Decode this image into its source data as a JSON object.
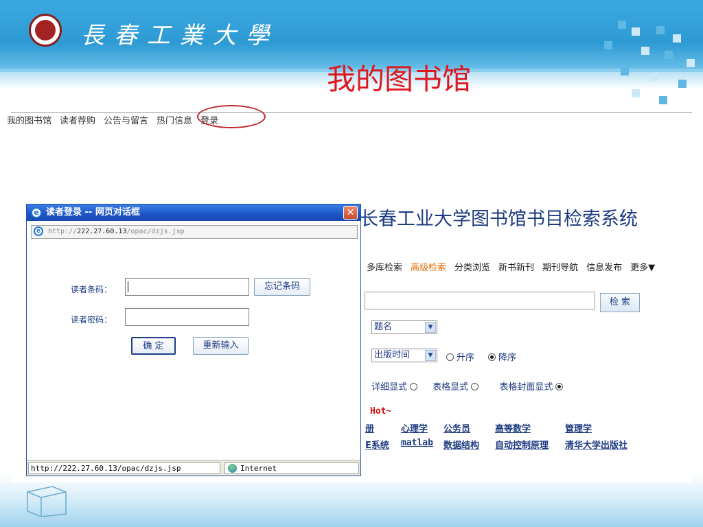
{
  "slide": {
    "university_name": "長春工業大學",
    "title": "我的图书馆"
  },
  "top_nav": {
    "items": [
      "我的图书馆",
      "读者荐购",
      "公告与留言",
      "热门信息",
      "登录"
    ]
  },
  "opac": {
    "title": "长春工业大学图书馆书目检索系统",
    "tabs": [
      "多库检索",
      "高级检索",
      "分类浏览",
      "新书新刊",
      "期刊导航",
      "信息发布",
      "更多▼"
    ],
    "active_tab": "高级检索",
    "search_button": "检 索",
    "field_select": "题名",
    "sort_select": "出版时间",
    "sort_asc": "升序",
    "sort_desc": "降序",
    "display_detail": "详细显式",
    "display_table": "表格显式",
    "display_cover": "表格封面显式",
    "hot_label": "Hot~",
    "hot_row1": [
      "册",
      "心理学",
      "公务员",
      "高等数学",
      "管理学"
    ],
    "hot_row2": [
      "E系统",
      "matlab",
      "数据结构",
      "自动控制原理",
      "清华大学出版社"
    ]
  },
  "dialog": {
    "title": "读者登录 -- 网页对话框",
    "address_prefix": "http://",
    "address_host": "222.27.60.13",
    "address_path": "/opac/dzjs.jsp",
    "barcode_label": "读者条码：",
    "forgot_button": "忘记条码",
    "password_label": "读者密码：",
    "confirm_button": "确  定",
    "reset_button": "重新输入",
    "status_url": "http://222.27.60.13/opac/dzjs.jsp",
    "status_zone": "Internet"
  },
  "icons": {
    "ie": "ie-logo-icon",
    "close": "close-icon",
    "globe": "globe-icon",
    "dropdown": "chevron-down-icon"
  },
  "colors": {
    "header_blue": "#2e9ad4",
    "title_red": "#e0161e",
    "link_blue": "#1d3a82",
    "active_orange": "#e06a00",
    "dialog_title": "#1d56c9"
  }
}
